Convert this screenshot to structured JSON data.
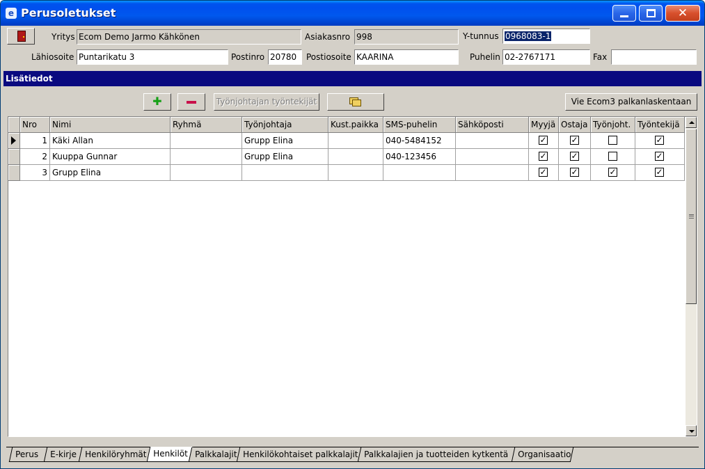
{
  "window": {
    "title": "Perusoletukset",
    "app_icon_letter": "e"
  },
  "header": {
    "yritys_label": "Yritys",
    "yritys_value": "Ecom Demo Jarmo Kähkönen",
    "asiakasnro_label": "Asiakasnro",
    "asiakasnro_value": "998",
    "ytunnus_label": "Y-tunnus",
    "ytunnus_value": "0968083-1",
    "lahiosoite_label": "Lähiosoite",
    "lahiosoite_value": "Puntarikatu 3",
    "postinro_label": "Postinro",
    "postinro_value": "20780",
    "postiosoite_label": "Postiosoite",
    "postiosoite_value": "KAARINA",
    "puhelin_label": "Puhelin",
    "puhelin_value": "02-2767171",
    "fax_label": "Fax",
    "fax_value": ""
  },
  "section": {
    "title": "Lisätiedot"
  },
  "toolbar": {
    "add_icon": "plus-icon",
    "remove_icon": "minus-icon",
    "supervisor_employees_label": "Työnjohtajan työntekijät",
    "folder_icon": "folders-icon",
    "export_label": "Vie Ecom3 palkanlaskentaan"
  },
  "table": {
    "columns": [
      "Nro",
      "Nimi",
      "Ryhmä",
      "Työnjohtaja",
      "Kust.paikka",
      "SMS-puhelin",
      "Sähköposti",
      "Myyjä",
      "Ostaja",
      "Työnjoht.",
      "Työntekijä"
    ],
    "rows": [
      {
        "nro": "1",
        "nimi": "Käki Allan",
        "ryhma": "",
        "tyonjohtaja": "Grupp Elina",
        "kustpaikka": "",
        "sms": "040-5484152",
        "sahkoposti": "",
        "myyja": true,
        "ostaja": true,
        "tyonjoht": false,
        "tyontekija": true
      },
      {
        "nro": "2",
        "nimi": "Kuuppa Gunnar",
        "ryhma": "",
        "tyonjohtaja": "Grupp Elina",
        "kustpaikka": "",
        "sms": "040-123456",
        "sahkoposti": "",
        "myyja": true,
        "ostaja": true,
        "tyonjoht": false,
        "tyontekija": true
      },
      {
        "nro": "3",
        "nimi": "Grupp Elina",
        "ryhma": "",
        "tyonjohtaja": "",
        "kustpaikka": "",
        "sms": "",
        "sahkoposti": "",
        "myyja": true,
        "ostaja": true,
        "tyonjoht": true,
        "tyontekija": true
      }
    ]
  },
  "tabs": [
    "Perus",
    "E-kirje",
    "Henkilöryhmät",
    "Henkilöt",
    "Palkkalajit",
    "Henkilökohtaiset palkkalajit",
    "Palkkalajien ja tuotteiden kytkentä",
    "Organisaatio"
  ],
  "active_tab": "Henkilöt",
  "colors": {
    "titlebar": "#0054e3",
    "section_bar": "#0a0a80",
    "face": "#d4d0c8",
    "selection": "#0a246a"
  }
}
